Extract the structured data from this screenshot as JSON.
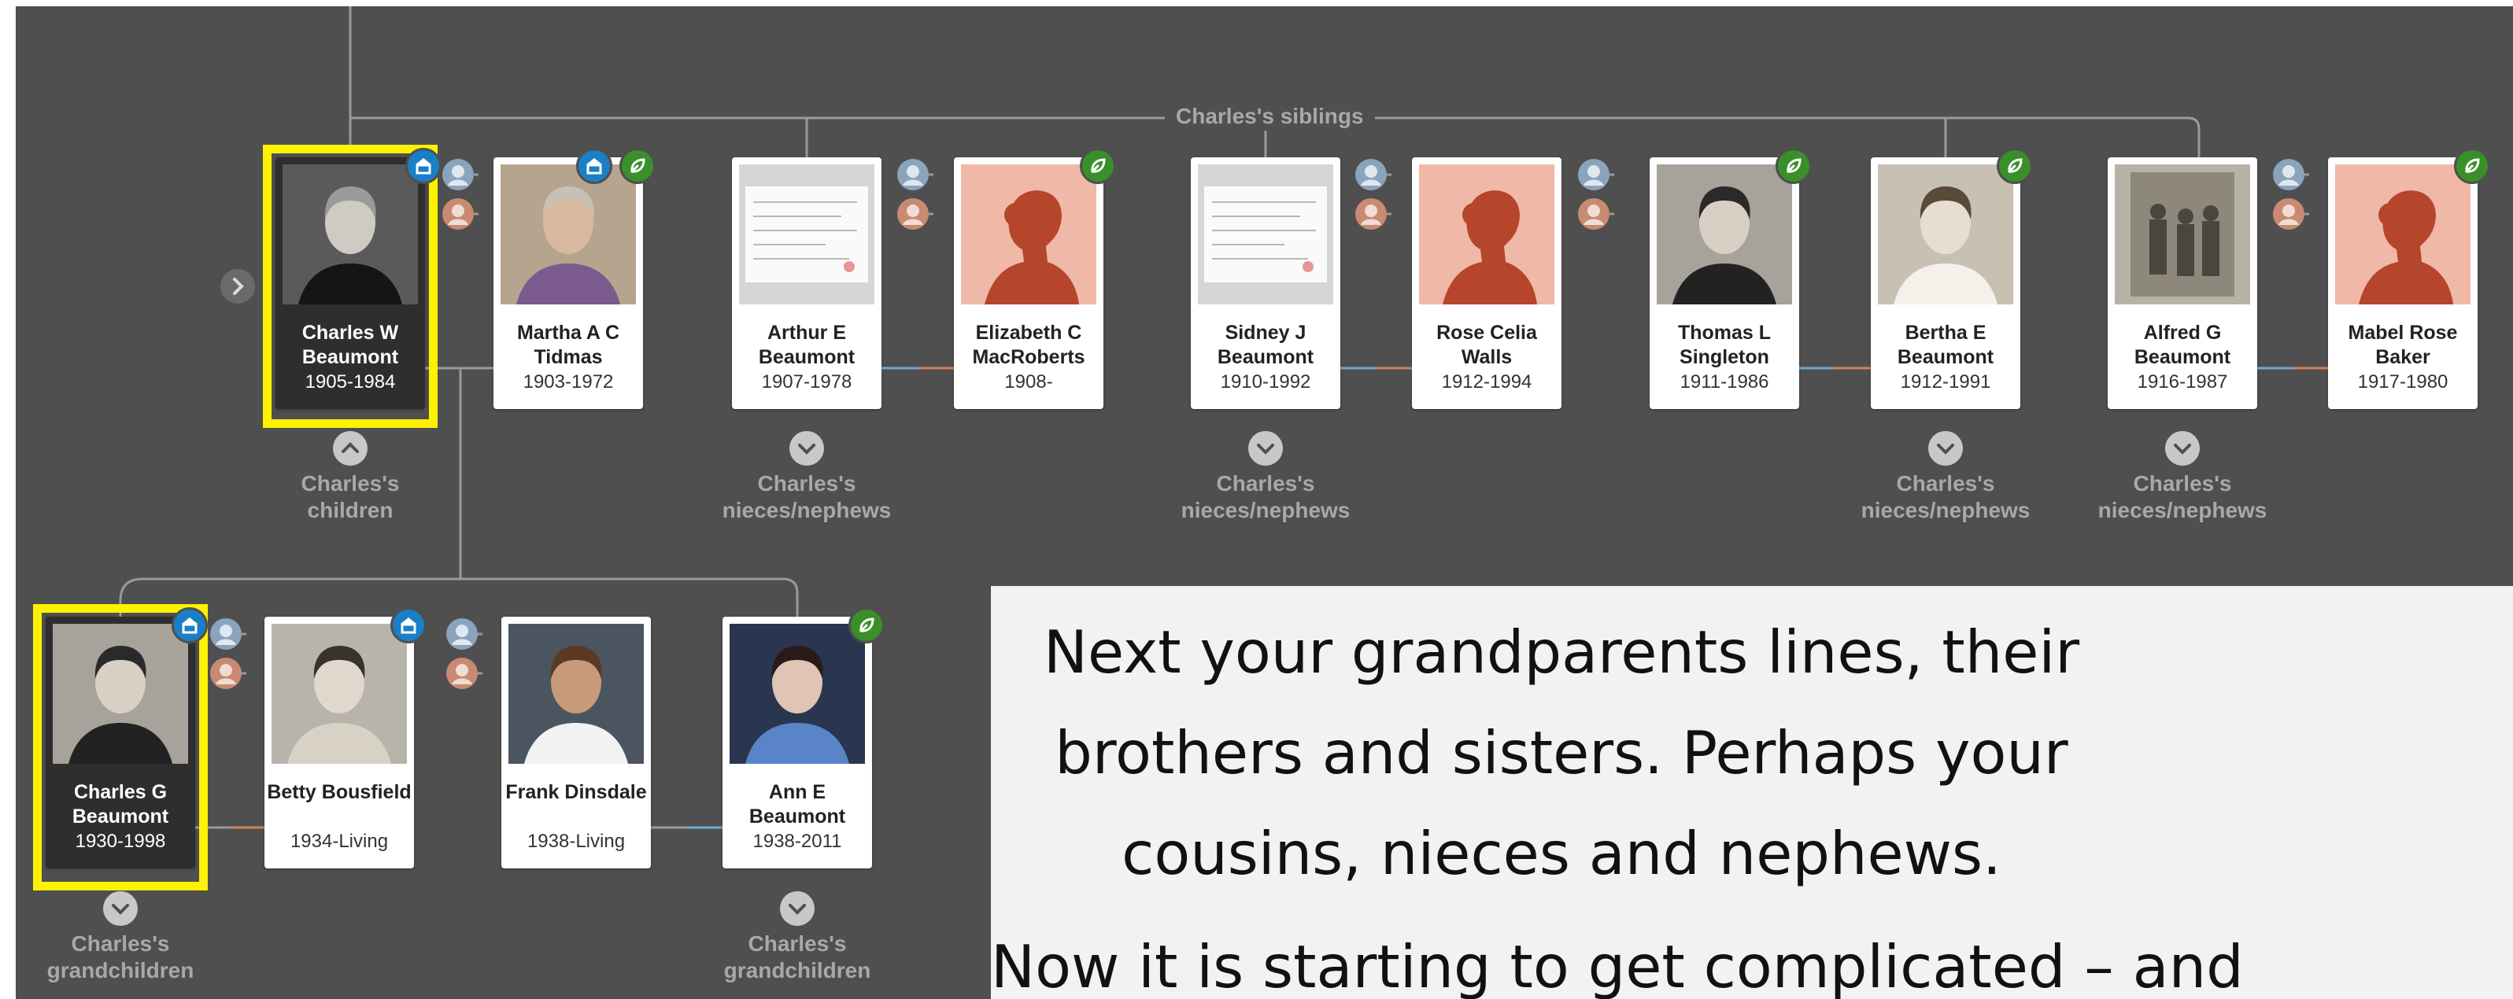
{
  "tree": {
    "siblings_label": "Charles's siblings",
    "people": [
      {
        "key": "charles_w",
        "name": "Charles W Beaumont",
        "dates": "1905-1984",
        "photo": "photo-man-old"
      },
      {
        "key": "martha",
        "name": "Martha A C Tidmas",
        "dates": "1903-1972",
        "photo": "photo-woman-old"
      },
      {
        "key": "arthur",
        "name": "Arthur E Beaumont",
        "dates": "1907-1978",
        "photo": "document-record"
      },
      {
        "key": "elizabeth",
        "name": "Elizabeth C MacRoberts",
        "dates": "1908-",
        "photo": "silhouette-woman"
      },
      {
        "key": "sidney",
        "name": "Sidney J Beaumont",
        "dates": "1910-1992",
        "photo": "document-record"
      },
      {
        "key": "rose",
        "name": "Rose Celia Walls",
        "dates": "1912-1994",
        "photo": "silhouette-woman"
      },
      {
        "key": "thomas",
        "name": "Thomas L Singleton",
        "dates": "1911-1986",
        "photo": "photo-man-young"
      },
      {
        "key": "bertha",
        "name": "Bertha E Beaumont",
        "dates": "1912-1991",
        "photo": "photo-bride"
      },
      {
        "key": "alfred",
        "name": "Alfred G Beaumont",
        "dates": "1916-1987",
        "photo": "photo-group"
      },
      {
        "key": "mabel",
        "name": "Mabel Rose Baker",
        "dates": "1917-1980",
        "photo": "silhouette-woman"
      },
      {
        "key": "charles_g",
        "name": "Charles G Beaumont",
        "dates": "1930-1998",
        "photo": "photo-man-young"
      },
      {
        "key": "betty",
        "name": "Betty Bousfield",
        "dates": "1934-Living",
        "photo": "photo-woman-young"
      },
      {
        "key": "frank",
        "name": "Frank Dinsdale",
        "dates": "1938-Living",
        "photo": "photo-man-shirt"
      },
      {
        "key": "ann",
        "name": "Ann E Beaumont",
        "dates": "1938-2011",
        "photo": "photo-woman-blue"
      }
    ],
    "group_labels": [
      {
        "key": "children",
        "line1": "Charles's",
        "line2": "children"
      },
      {
        "key": "nieces1",
        "line1": "Charles's",
        "line2": "nieces/nephews"
      },
      {
        "key": "nieces2",
        "line1": "Charles's",
        "line2": "nieces/nephews"
      },
      {
        "key": "nieces3",
        "line1": "Charles's",
        "line2": "nieces/nephews"
      },
      {
        "key": "nieces4",
        "line1": "Charles's",
        "line2": "nieces/nephews"
      },
      {
        "key": "grand1",
        "line1": "Charles's",
        "line2": "grandchildren"
      },
      {
        "key": "grand2",
        "line1": "Charles's",
        "line2": "grandchildren"
      }
    ],
    "hint_badges": {
      "green": "leaf-hint-icon",
      "blue": "record-hint-icon"
    },
    "colors": {
      "background": "#4f4f4f",
      "highlight": "#fff200",
      "line": "#9a9a9a",
      "spouse_line_blue": "#6fa8d0",
      "spouse_line_orange": "#d0835a",
      "silhouette_bg": "#f0b8a6",
      "silhouette_fg": "#b5452b"
    }
  },
  "text_panel": {
    "paragraph1": "Next your grandparents lines, their brothers and sisters. Perhaps your cousins, nieces and nephews.",
    "paragraph2": "Now it is starting to get complicated – and"
  }
}
